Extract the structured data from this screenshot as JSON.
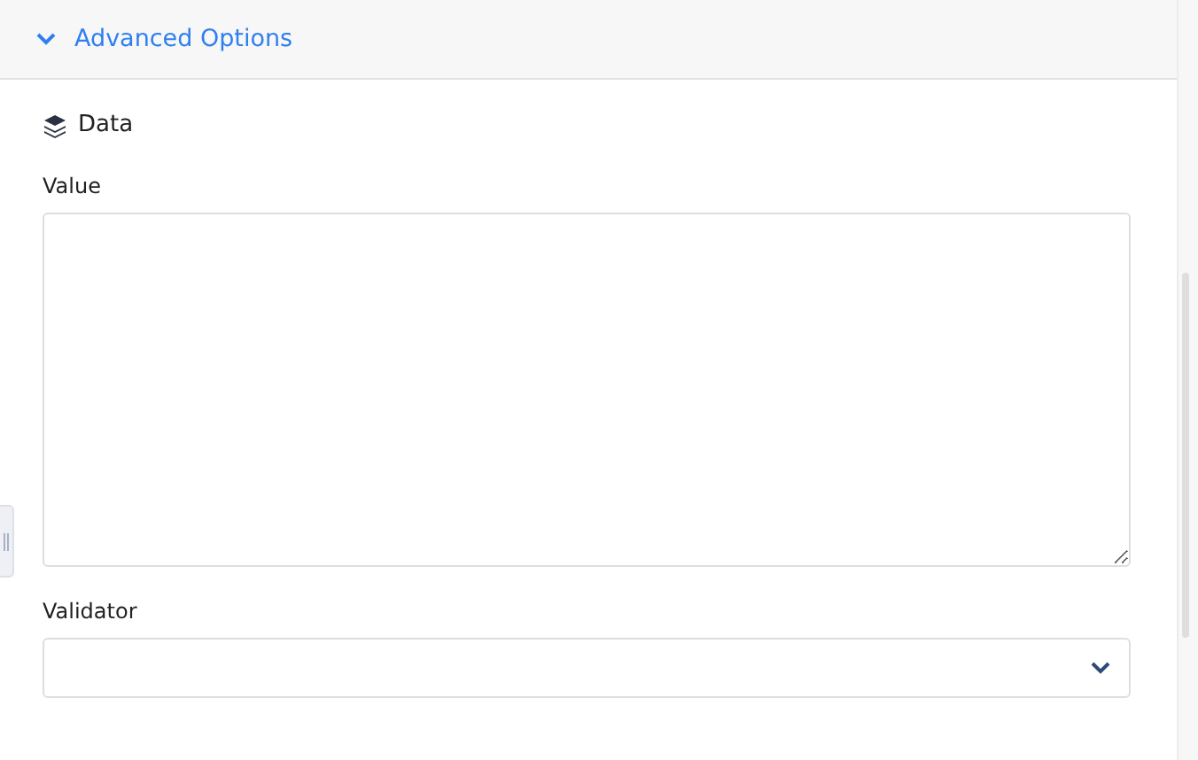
{
  "section": {
    "title": "Advanced Options",
    "expanded": true
  },
  "group": {
    "title": "Data"
  },
  "fields": [
    {
      "kind": "textarea",
      "label": "Value"
    },
    {
      "kind": "select",
      "label": "Validator"
    }
  ]
}
